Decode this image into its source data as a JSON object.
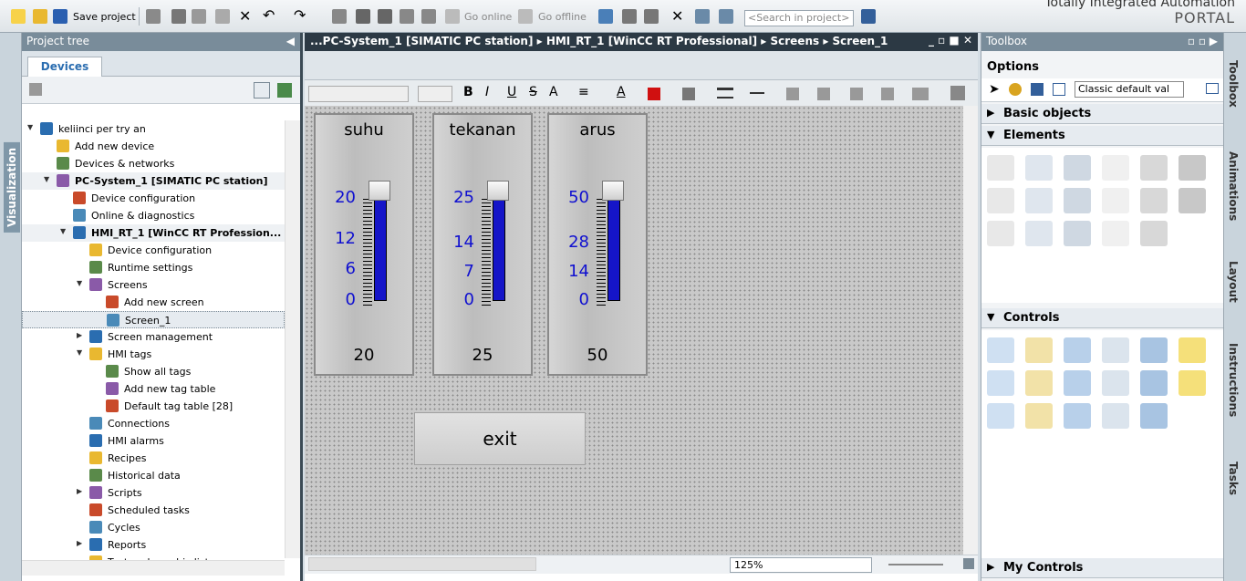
{
  "toolbar": {
    "save_project": "Save project",
    "go_online": "Go online",
    "go_offline": "Go offline",
    "search_placeholder": "<Search in project>",
    "brand_line1": "Totally Integrated Automation",
    "brand_line2": "PORTAL"
  },
  "left_sidebar": {
    "label": "Visualization"
  },
  "project_tree": {
    "title": "Project tree",
    "tab_devices": "Devices",
    "items": [
      {
        "label": "keliinci per try an",
        "level": 0,
        "arrow": "▼"
      },
      {
        "label": "Add new device",
        "level": 1,
        "arrow": ""
      },
      {
        "label": "Devices & networks",
        "level": 1,
        "arrow": ""
      },
      {
        "label": "PC-System_1 [SIMATIC PC station]",
        "level": 1,
        "arrow": "▼"
      },
      {
        "label": "Device configuration",
        "level": 2,
        "arrow": ""
      },
      {
        "label": "Online & diagnostics",
        "level": 2,
        "arrow": ""
      },
      {
        "label": "HMI_RT_1 [WinCC RT Profession...",
        "level": 2,
        "arrow": "▼"
      },
      {
        "label": "Device configuration",
        "level": 3,
        "arrow": ""
      },
      {
        "label": "Runtime settings",
        "level": 3,
        "arrow": ""
      },
      {
        "label": "Screens",
        "level": 3,
        "arrow": "▼"
      },
      {
        "label": "Add new screen",
        "level": 4,
        "arrow": ""
      },
      {
        "label": "Screen_1",
        "level": 4,
        "arrow": ""
      },
      {
        "label": "Screen management",
        "level": 3,
        "arrow": "▶"
      },
      {
        "label": "HMI tags",
        "level": 3,
        "arrow": "▼"
      },
      {
        "label": "Show all tags",
        "level": 4,
        "arrow": ""
      },
      {
        "label": "Add new tag table",
        "level": 4,
        "arrow": ""
      },
      {
        "label": "Default tag table [28]",
        "level": 4,
        "arrow": ""
      },
      {
        "label": "Connections",
        "level": 3,
        "arrow": ""
      },
      {
        "label": "HMI alarms",
        "level": 3,
        "arrow": ""
      },
      {
        "label": "Recipes",
        "level": 3,
        "arrow": ""
      },
      {
        "label": "Historical data",
        "level": 3,
        "arrow": ""
      },
      {
        "label": "Scripts",
        "level": 3,
        "arrow": "▶"
      },
      {
        "label": "Scheduled tasks",
        "level": 3,
        "arrow": ""
      },
      {
        "label": "Cycles",
        "level": 3,
        "arrow": ""
      },
      {
        "label": "Reports",
        "level": 3,
        "arrow": "▶"
      },
      {
        "label": "Text and graphic lists",
        "level": 3,
        "arrow": ""
      }
    ]
  },
  "editor": {
    "breadcrumb": "...PC-System_1 [SIMATIC PC station]  ▸  HMI_RT_1 [WinCC RT Professional]  ▸  Screens  ▸  Screen_1",
    "zoom": "125%",
    "gauges": [
      {
        "title": "suhu",
        "value": "20",
        "max": 20,
        "current": 20,
        "ticks": [
          "20",
          "12",
          "6",
          "0"
        ]
      },
      {
        "title": "tekanan",
        "value": "25",
        "max": 25,
        "current": 25,
        "ticks": [
          "25",
          "14",
          "7",
          "0"
        ]
      },
      {
        "title": "arus",
        "value": "50",
        "max": 50,
        "current": 50,
        "ticks": [
          "50",
          "28",
          "14",
          "0"
        ]
      }
    ],
    "exit_button": "exit"
  },
  "toolbox": {
    "title": "Toolbox",
    "options": "Options",
    "style_select": "Classic default val",
    "basic_objects": "Basic objects",
    "elements": "Elements",
    "controls": "Controls",
    "my_controls": "My Controls",
    "element_icons": [
      "io-field-icon",
      "symbolic-io-icon",
      "list-icon",
      "dropdown-icon",
      "button-icon",
      "round-button-icon",
      "symbol-list-icon",
      "graphic-view-icon",
      "bar-icon",
      "gauge-icon",
      "slider-icon",
      "scrollbar-icon",
      "checkbox-icon",
      "option-button-icon",
      "gauge-dial-icon",
      "clock-icon",
      "switch-icon"
    ],
    "control_icons": [
      "alarm-view-icon",
      "user-view-icon",
      "browser-icon",
      "media-player-icon",
      "printer-icon",
      "status-alarm-icon",
      "trend-view-icon",
      "f-x-trend-icon",
      "table-view-icon",
      "value-table-icon",
      "diagnostic-icon",
      "play-icon",
      "channel-diag-icon",
      "plc-code-icon",
      "controller-icon",
      "recipe-view-icon",
      "sysdiag-icon"
    ],
    "colors": {
      "accent": "#1515c8",
      "header": "#798c9a",
      "crumb": "#2c3944"
    }
  },
  "right_sidebar": {
    "tabs": [
      "Toolbox",
      "Animations",
      "Layout",
      "Instructions",
      "Tasks"
    ]
  }
}
